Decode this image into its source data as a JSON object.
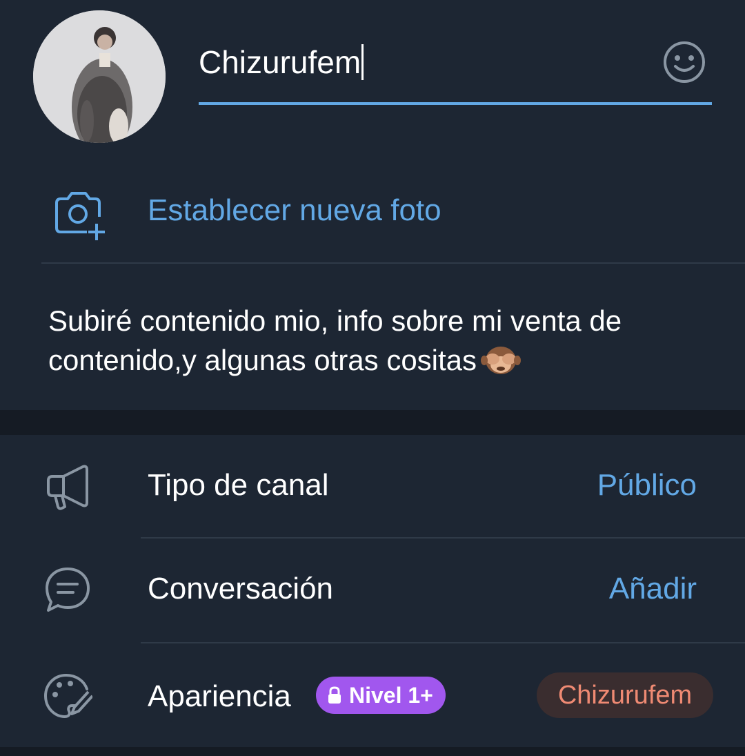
{
  "profile": {
    "name_value": "Chizurufem",
    "avatar_label": "channel-photo",
    "emoji_icon": "smile-icon"
  },
  "set_photo": {
    "label": "Establecer nueva foto",
    "icon": "camera-add-icon"
  },
  "description": {
    "text": "Subiré contenido mio, info sobre mi venta de contenido,y algunas otras cositas",
    "emoji": "see-no-evil-monkey"
  },
  "settings": {
    "channel_type": {
      "label": "Tipo de canal",
      "value": "Público",
      "icon": "megaphone-icon"
    },
    "discussion": {
      "label": "Conversación",
      "value": "Añadir",
      "icon": "chat-bubble-icon"
    },
    "appearance": {
      "label": "Apariencia",
      "badge": "Nivel 1+",
      "badge_icon": "lock-icon",
      "value": "Chizurufem",
      "icon": "palette-icon"
    }
  },
  "colors": {
    "background": "#1d2633",
    "accent_blue": "#62a8e5",
    "badge_purple": "#a157ee",
    "chip_text": "#ef8a73",
    "chip_bg": "#3a2d2f",
    "icon_gray": "#8a96a3"
  }
}
